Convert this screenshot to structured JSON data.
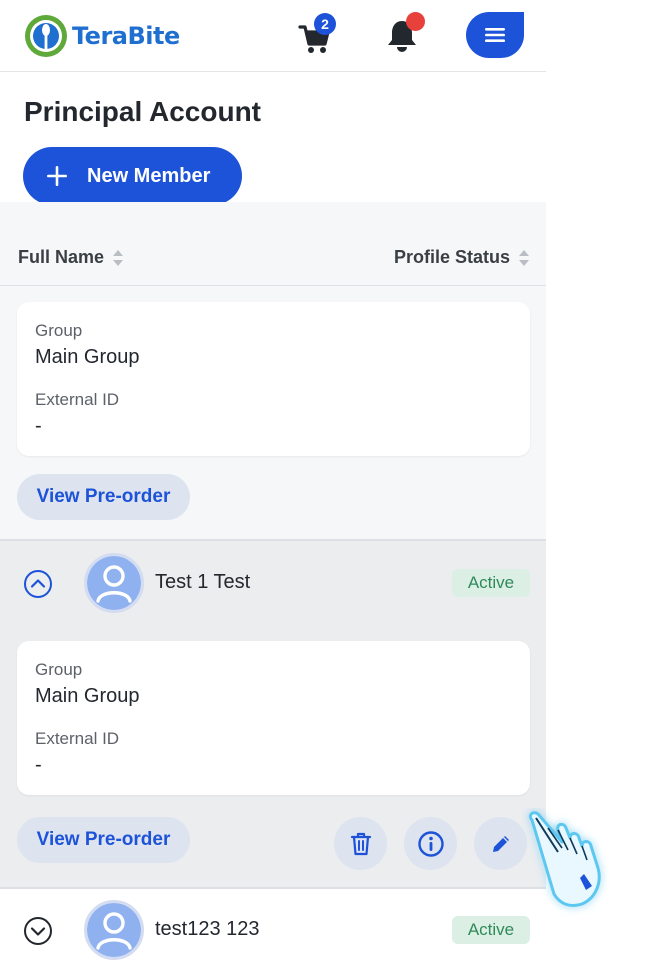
{
  "header": {
    "logo_text": "TeraBite",
    "cart_count": "2",
    "colors": {
      "primary": "#1d53d8",
      "notification": "#e8413b",
      "logo_green": "#5fa83a"
    }
  },
  "page": {
    "title": "Principal Account",
    "new_member_label": "New Member"
  },
  "table": {
    "columns": [
      "Full Name",
      "Profile Status"
    ],
    "first_card": {
      "group_label": "Group",
      "group_value": "Main Group",
      "external_id_label": "External ID",
      "external_id_value": "-"
    },
    "first_preorder_label": "View Pre-order",
    "members": [
      {
        "name": "Test 1 Test",
        "status": "Active",
        "expanded": true,
        "group_label": "Group",
        "group_value": "Main Group",
        "external_id_label": "External ID",
        "external_id_value": "-",
        "preorder_label": "View Pre-order",
        "actions": [
          "trash-icon",
          "info-icon",
          "pencil-icon"
        ]
      },
      {
        "name": "test123 123",
        "status": "Active",
        "expanded": false
      }
    ]
  }
}
